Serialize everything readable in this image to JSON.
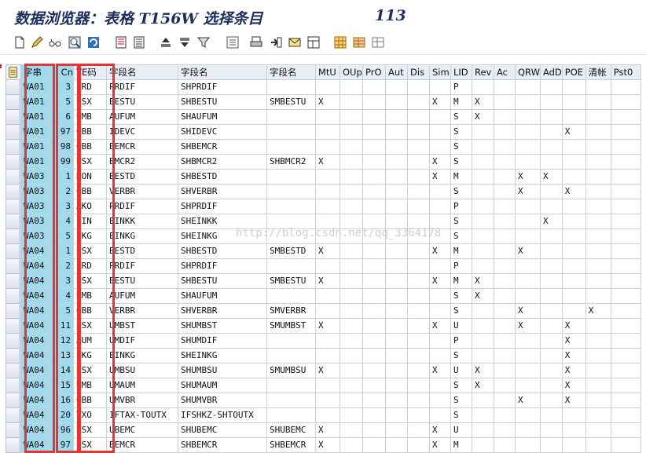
{
  "window": {
    "title": "数据浏览器：表格 T156W 选择条目",
    "count": "113"
  },
  "toolbar": {
    "icons": [
      "new-document-icon",
      "edit-pencil-icon",
      "glasses-display-icon",
      "find-icon",
      "refresh-icon",
      "detail-icon",
      "list-icon",
      "sort-ascending-icon",
      "sort-descending-icon",
      "filter-icon",
      "settings-icon",
      "print-icon",
      "export-icon",
      "mail-icon",
      "layout-icon",
      "choose-layout-icon",
      "table-view-icon",
      "other-view-icon"
    ]
  },
  "table": {
    "columns": [
      "字串",
      "Cn",
      "TE码",
      "字段名",
      "字段名",
      "字段名",
      "MtU",
      "OUp",
      "PrO",
      "Aut",
      "Dis",
      "Sim",
      "LID",
      "Rev",
      "Ac",
      "QRW",
      "AdD",
      "POE",
      "清帐",
      "Pst0"
    ],
    "rows": [
      [
        "WA01",
        "3",
        "PRD",
        "PRDIF",
        "SHPRDIF",
        "",
        "",
        "",
        "",
        "",
        "",
        "",
        "P",
        "",
        "",
        "",
        "",
        "",
        "",
        ""
      ],
      [
        "WA01",
        "5",
        "BSX",
        "BESTU",
        "SHBESTU",
        "SMBESTU",
        "X",
        "",
        "",
        "",
        "",
        "X",
        "M",
        "X",
        "",
        "",
        "",
        "",
        "",
        ""
      ],
      [
        "WA01",
        "6",
        "UMB",
        "AUFUM",
        "SHAUFUM",
        "",
        "",
        "",
        "",
        "",
        "",
        "",
        "S",
        "X",
        "",
        "",
        "",
        "",
        "",
        ""
      ],
      [
        "WA01",
        "97",
        "GBB",
        "IDEVC",
        "SHIDEVC",
        "",
        "",
        "",
        "",
        "",
        "",
        "",
        "S",
        "",
        "",
        "",
        "",
        "X",
        "",
        ""
      ],
      [
        "WA01",
        "98",
        "GBB",
        "BEMCR",
        "SHBEMCR",
        "",
        "",
        "",
        "",
        "",
        "",
        "",
        "S",
        "",
        "",
        "",
        "",
        "",
        "",
        ""
      ],
      [
        "WA01",
        "99",
        "BSX",
        "BMCR2",
        "SHBMCR2",
        "SHBMCR2",
        "X",
        "",
        "",
        "",
        "",
        "X",
        "S",
        "",
        "",
        "",
        "",
        "",
        "",
        ""
      ],
      [
        "WA03",
        "1",
        "KON",
        "BESTD",
        "SHBESTD",
        "",
        "",
        "",
        "",
        "",
        "",
        "X",
        "M",
        "",
        "",
        "X",
        "X",
        "",
        "",
        ""
      ],
      [
        "WA03",
        "2",
        "GBB",
        "VERBR",
        "SHVERBR",
        "",
        "",
        "",
        "",
        "",
        "",
        "",
        "S",
        "",
        "",
        "X",
        "",
        "X",
        "",
        ""
      ],
      [
        "WA03",
        "3",
        "AKO",
        "PRDIF",
        "SHPRDIF",
        "",
        "",
        "",
        "",
        "",
        "",
        "",
        "P",
        "",
        "",
        "",
        "",
        "",
        "",
        ""
      ],
      [
        "WA03",
        "4",
        "EIN",
        "EINKK",
        "SHEINKK",
        "",
        "",
        "",
        "",
        "",
        "",
        "",
        "S",
        "",
        "",
        "",
        "X",
        "",
        "",
        ""
      ],
      [
        "WA03",
        "5",
        "EKG",
        "EINKG",
        "SHEINKG",
        "",
        "",
        "",
        "",
        "",
        "",
        "",
        "S",
        "",
        "",
        "",
        "",
        "",
        "",
        ""
      ],
      [
        "WA04",
        "1",
        "BSX",
        "BESTD",
        "SHBESTD",
        "SMBESTD",
        "X",
        "",
        "",
        "",
        "",
        "X",
        "M",
        "",
        "",
        "X",
        "",
        "",
        "",
        ""
      ],
      [
        "WA04",
        "2",
        "PRD",
        "PRDIF",
        "SHPRDIF",
        "",
        "",
        "",
        "",
        "",
        "",
        "",
        "P",
        "",
        "",
        "",
        "",
        "",
        "",
        ""
      ],
      [
        "WA04",
        "3",
        "BSX",
        "BESTU",
        "SHBESTU",
        "SMBESTU",
        "X",
        "",
        "",
        "",
        "",
        "X",
        "M",
        "X",
        "",
        "",
        "",
        "",
        "",
        ""
      ],
      [
        "WA04",
        "4",
        "UMB",
        "AUFUM",
        "SHAUFUM",
        "",
        "",
        "",
        "",
        "",
        "",
        "",
        "S",
        "X",
        "",
        "",
        "",
        "",
        "",
        ""
      ],
      [
        "WA04",
        "5",
        "GBB",
        "VERBR",
        "SHVERBR",
        "SMVERBR",
        "",
        "",
        "",
        "",
        "",
        "",
        "S",
        "",
        "",
        "X",
        "",
        "",
        "X",
        ""
      ],
      [
        "WA04",
        "11",
        "BSX",
        "UMBST",
        "SHUMBST",
        "SMUMBST",
        "X",
        "",
        "",
        "",
        "",
        "X",
        "U",
        "",
        "",
        "X",
        "",
        "X",
        "",
        ""
      ],
      [
        "WA04",
        "12",
        "AUM",
        "UMDIF",
        "SHUMDIF",
        "",
        "",
        "",
        "",
        "",
        "",
        "",
        "P",
        "",
        "",
        "",
        "",
        "X",
        "",
        ""
      ],
      [
        "WA04",
        "13",
        "EKG",
        "EINKG",
        "SHEINKG",
        "",
        "",
        "",
        "",
        "",
        "",
        "",
        "S",
        "",
        "",
        "",
        "",
        "X",
        "",
        ""
      ],
      [
        "WA04",
        "14",
        "BSX",
        "UMBSU",
        "SHUMBSU",
        "SMUMBSU",
        "X",
        "",
        "",
        "",
        "",
        "X",
        "U",
        "X",
        "",
        "",
        "",
        "X",
        "",
        ""
      ],
      [
        "WA04",
        "15",
        "UMB",
        "UMAUM",
        "SHUMAUM",
        "",
        "",
        "",
        "",
        "",
        "",
        "",
        "S",
        "X",
        "",
        "",
        "",
        "X",
        "",
        ""
      ],
      [
        "WA04",
        "16",
        "GBB",
        "UMVBR",
        "SHUMVBR",
        "",
        "",
        "",
        "",
        "",
        "",
        "",
        "S",
        "",
        "",
        "X",
        "",
        "X",
        "",
        ""
      ],
      [
        "WA04",
        "20",
        "TXO",
        "IFTAX-TOUTX",
        "IFSHKZ-SHTOUTX",
        "",
        "",
        "",
        "",
        "",
        "",
        "",
        "S",
        "",
        "",
        "",
        "",
        "",
        "",
        ""
      ],
      [
        "WA04",
        "96",
        "BSX",
        "UBEMC",
        "SHUBEMC",
        "SHUBEMC",
        "X",
        "",
        "",
        "",
        "",
        "X",
        "U",
        "",
        "",
        "",
        "",
        "",
        "",
        ""
      ],
      [
        "WA04",
        "97",
        "BSX",
        "BEMCR",
        "SHBEMCR",
        "SHBEMCR",
        "X",
        "",
        "",
        "",
        "",
        "X",
        "M",
        "",
        "",
        "",
        "",
        "",
        "",
        ""
      ]
    ]
  },
  "watermark": "http://blog.csdn.net/qq_3364178",
  "colors": {
    "key_column": "#9fdbec",
    "highlight_box": "#e63434",
    "title": "#1c2f5c"
  }
}
